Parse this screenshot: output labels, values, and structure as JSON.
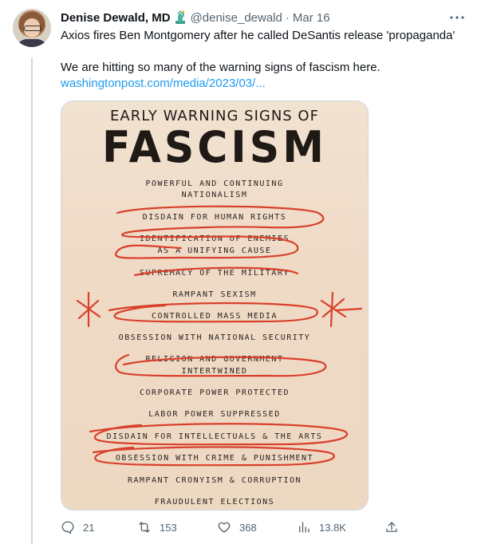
{
  "tweet": {
    "author_name": "Denise Dewald, MD",
    "handle": "@denise_dewald",
    "separator": "·",
    "date": "Mar 16",
    "line1": "Axios fires Ben Montgomery after he called DeSantis release 'propaganda'",
    "line2": "We are hitting so many of the warning signs of fascism here.",
    "link_text": "washingtonpost.com/media/2023/03/..."
  },
  "media": {
    "subtitle": "EARLY WARNING SIGNS OF",
    "title": "FASCISM",
    "items": [
      "POWERFUL AND CONTINUING",
      "NATIONALISM",
      "DISDAIN FOR HUMAN RIGHTS",
      "IDENTIFICATION OF ENEMIES",
      "AS A UNIFYING CAUSE",
      "SUPREMACY OF THE MILITARY",
      "RAMPANT SEXISM",
      "CONTROLLED MASS MEDIA",
      "OBSESSION WITH NATIONAL SECURITY",
      "RELIGION AND GOVERNMENT",
      "INTERTWINED",
      "CORPORATE POWER PROTECTED",
      "LABOR POWER SUPPRESSED",
      "DISDAIN FOR INTELLECTUALS & THE ARTS",
      "OBSESSION WITH CRIME & PUNISHMENT",
      "RAMPANT CRONYISM & CORRUPTION",
      "FRAUDULENT ELECTIONS"
    ]
  },
  "actions": {
    "replies": "21",
    "retweets": "153",
    "likes": "368",
    "views": "13.8K"
  },
  "colors": {
    "link": "#1d9bf0",
    "muted": "#536471",
    "annotation_red": "#d9402b"
  }
}
